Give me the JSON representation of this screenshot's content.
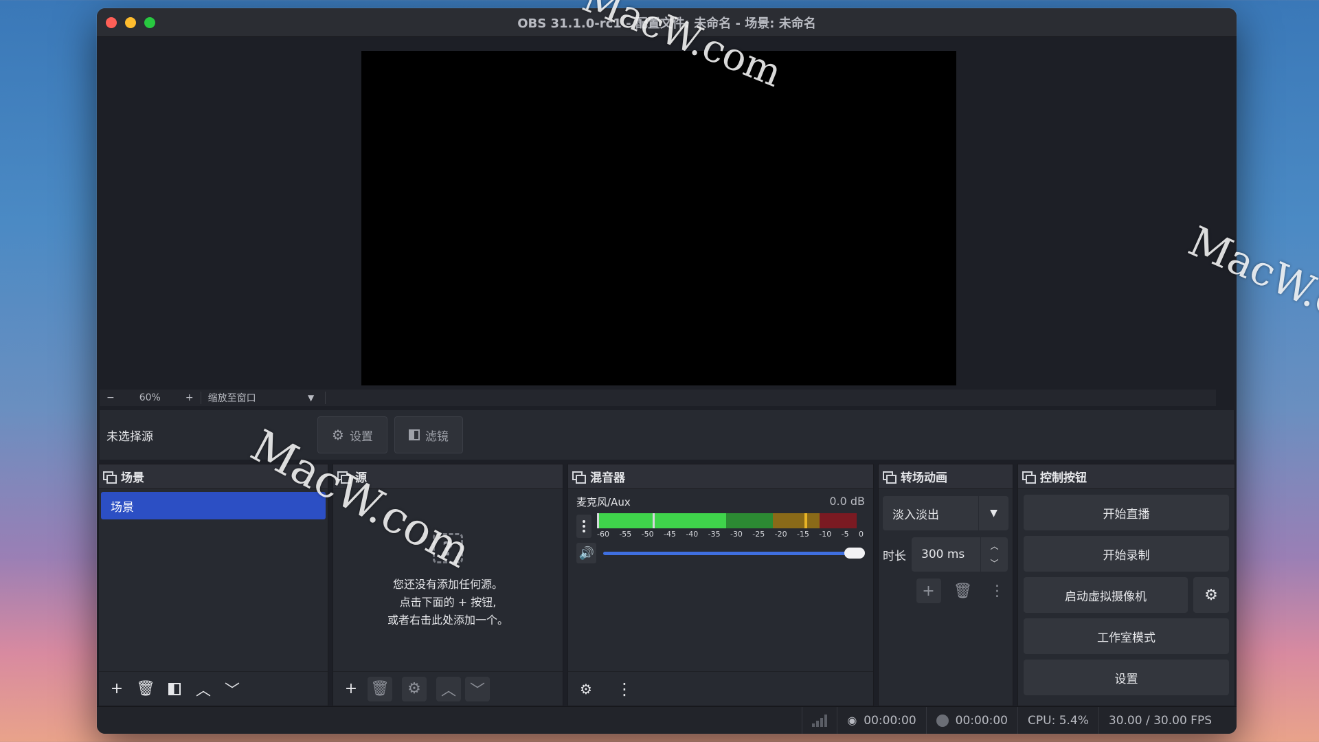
{
  "window": {
    "title": "OBS 31.1.0-rc1 - 配置文件: 未命名 - 场景: 未命名"
  },
  "zoom": {
    "minus": "−",
    "level": "60%",
    "plus": "+",
    "fit_label": "缩放至窗口",
    "dropdown": "▼"
  },
  "source_toolbar": {
    "no_source": "未选择源",
    "settings_label": "设置",
    "filters_label": "滤镜"
  },
  "docks": {
    "scenes": {
      "title": "场景",
      "items": [
        "场景"
      ]
    },
    "sources": {
      "title": "源",
      "empty_line1": "您还没有添加任何源。",
      "empty_line2": "点击下面的 + 按钮,",
      "empty_line3": "或者右击此处添加一个。"
    },
    "mixer": {
      "title": "混音器",
      "channel_name": "麦克风/Aux",
      "channel_db": "0.0 dB",
      "ticks": [
        "-60",
        "-55",
        "-50",
        "-45",
        "-40",
        "-35",
        "-30",
        "-25",
        "-20",
        "-15",
        "-10",
        "-5",
        "0"
      ],
      "volume_fraction": 1.0
    },
    "transitions": {
      "title": "转场动画",
      "selected": "淡入淡出",
      "duration_label": "时长",
      "duration_value": "300 ms"
    },
    "controls": {
      "title": "控制按钮",
      "start_stream": "开始直播",
      "start_record": "开始录制",
      "virtual_cam": "启动虚拟摄像机",
      "studio_mode": "工作室模式",
      "settings": "设置"
    }
  },
  "status": {
    "stream_time": "00:00:00",
    "record_time": "00:00:00",
    "cpu": "CPU: 5.4%",
    "fps": "30.00 / 30.00 FPS"
  },
  "watermark": "MacW.com",
  "colors": {
    "accent": "#2c4fc4",
    "meter_green": "#3fd44b",
    "meter_yellow": "#d6a620",
    "meter_red": "#c0202a"
  }
}
